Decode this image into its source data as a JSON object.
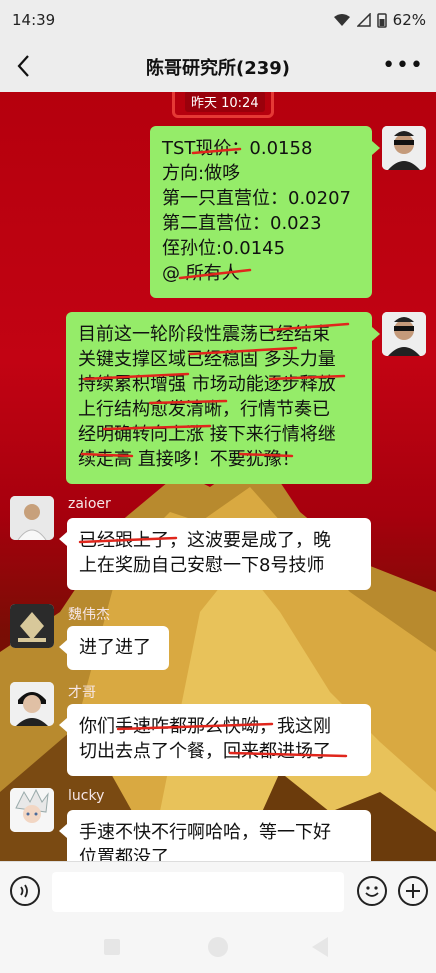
{
  "status": {
    "time": "14:39",
    "battery": "62%"
  },
  "header": {
    "title": "陈哥研究所(239)"
  },
  "chat": {
    "timestamp": "昨天 10:24",
    "messages": [
      {
        "sender": "",
        "side": "right",
        "lines": [
          "TST现价：0.0158",
          "方向:做哆",
          "第一只直营位：0.0207",
          "第二直营位：0.023",
          "侄孙位:0.0145",
          "@ 所有人"
        ]
      },
      {
        "sender": "",
        "side": "right",
        "lines": [
          "目前这一轮阶段性震荡已经结束",
          "关键支撑区域已经稳固 多头力量",
          "持续累积增强 市场动能逐步释放",
          "上行结构愈发清晰，行情节奏已",
          "经明确转向上涨 接下来行情将继",
          "续走高 直接哆！不要犹豫！"
        ]
      },
      {
        "sender": "zaioer",
        "side": "left",
        "lines": [
          "已经跟上了，这波要是成了，晚",
          "上在奖励自己安慰一下8号技师"
        ]
      },
      {
        "sender": "魏伟杰",
        "side": "left",
        "lines": [
          "进了进了"
        ]
      },
      {
        "sender": "才哥",
        "side": "left",
        "lines": [
          "你们手速咋都那么快呦，我这刚",
          "切出去点了个餐，回来都进场了"
        ]
      },
      {
        "sender": "lucky",
        "side": "left",
        "lines": [
          "手速不快不行啊哈哈，等一下好",
          "位置都没了"
        ]
      }
    ]
  }
}
